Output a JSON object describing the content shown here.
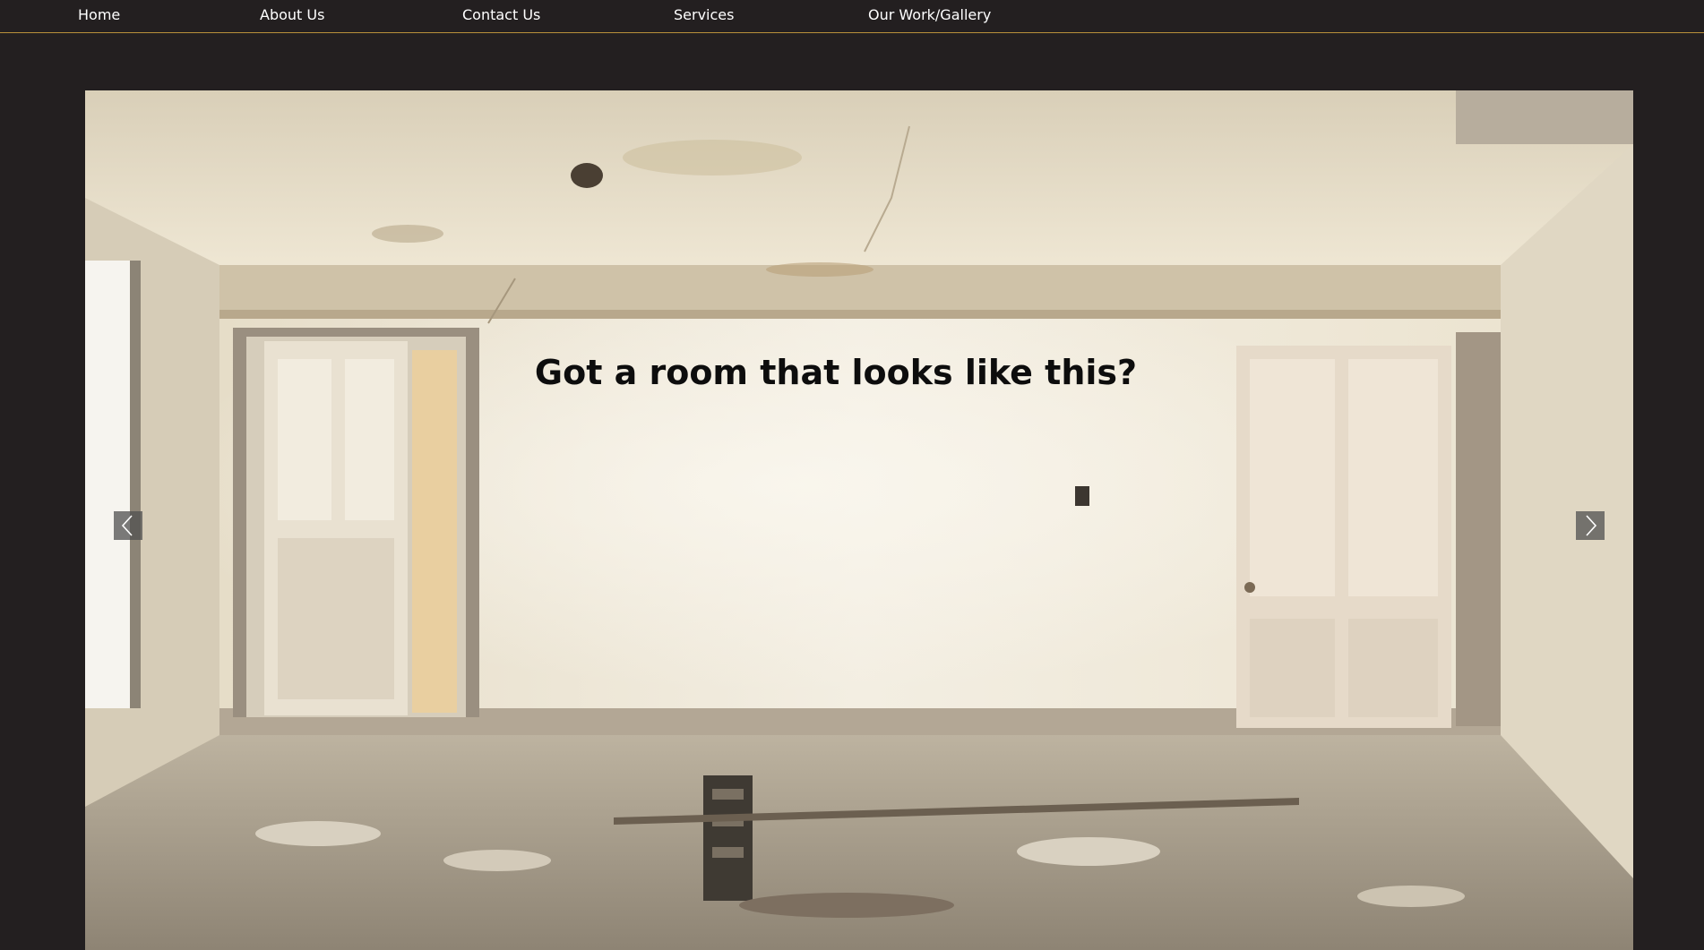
{
  "nav": {
    "items": [
      {
        "label": "Home"
      },
      {
        "label": "About Us"
      },
      {
        "label": "Contact Us"
      },
      {
        "label": "Services"
      },
      {
        "label": "Our Work/Gallery"
      }
    ]
  },
  "slider": {
    "caption": "Got a room that looks like this?",
    "prev_icon": "chevron-left-icon",
    "next_icon": "chevron-right-icon"
  },
  "colors": {
    "background": "#231f20",
    "nav_border": "#b9913a",
    "nav_text": "#ffffff",
    "caption_text": "#0d0d0d"
  }
}
